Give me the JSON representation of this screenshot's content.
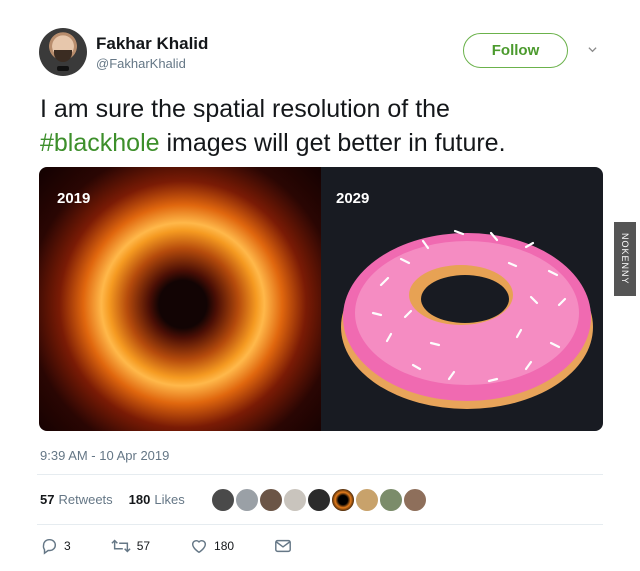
{
  "user": {
    "name": "Fakhar Khalid",
    "handle": "@FakharKhalid"
  },
  "follow_button": {
    "label": "Follow"
  },
  "tweet": {
    "text_before": "I am sure the spatial resolution of the",
    "hashtag": "#blackhole",
    "text_after": " images will get better in future."
  },
  "media": {
    "left_label": "2019",
    "right_label": "2029",
    "left_caption_colors": {
      "core": "#120404",
      "ring": "#f59a21"
    },
    "right_caption_colors": {
      "bg": "#181b22",
      "icing": "#f06ab1",
      "dough": "#f0b25c"
    }
  },
  "timestamp": "9:39 AM - 10 Apr 2019",
  "stats": {
    "retweets_count": "57",
    "retweets_label": "Retweets",
    "likes_count": "180",
    "likes_label": "Likes"
  },
  "actions": {
    "replies": "3",
    "retweets": "57",
    "likes": "180"
  },
  "watermark": "NOKENNY",
  "colors": {
    "accent": "#4b9a2d",
    "muted": "#657786"
  }
}
